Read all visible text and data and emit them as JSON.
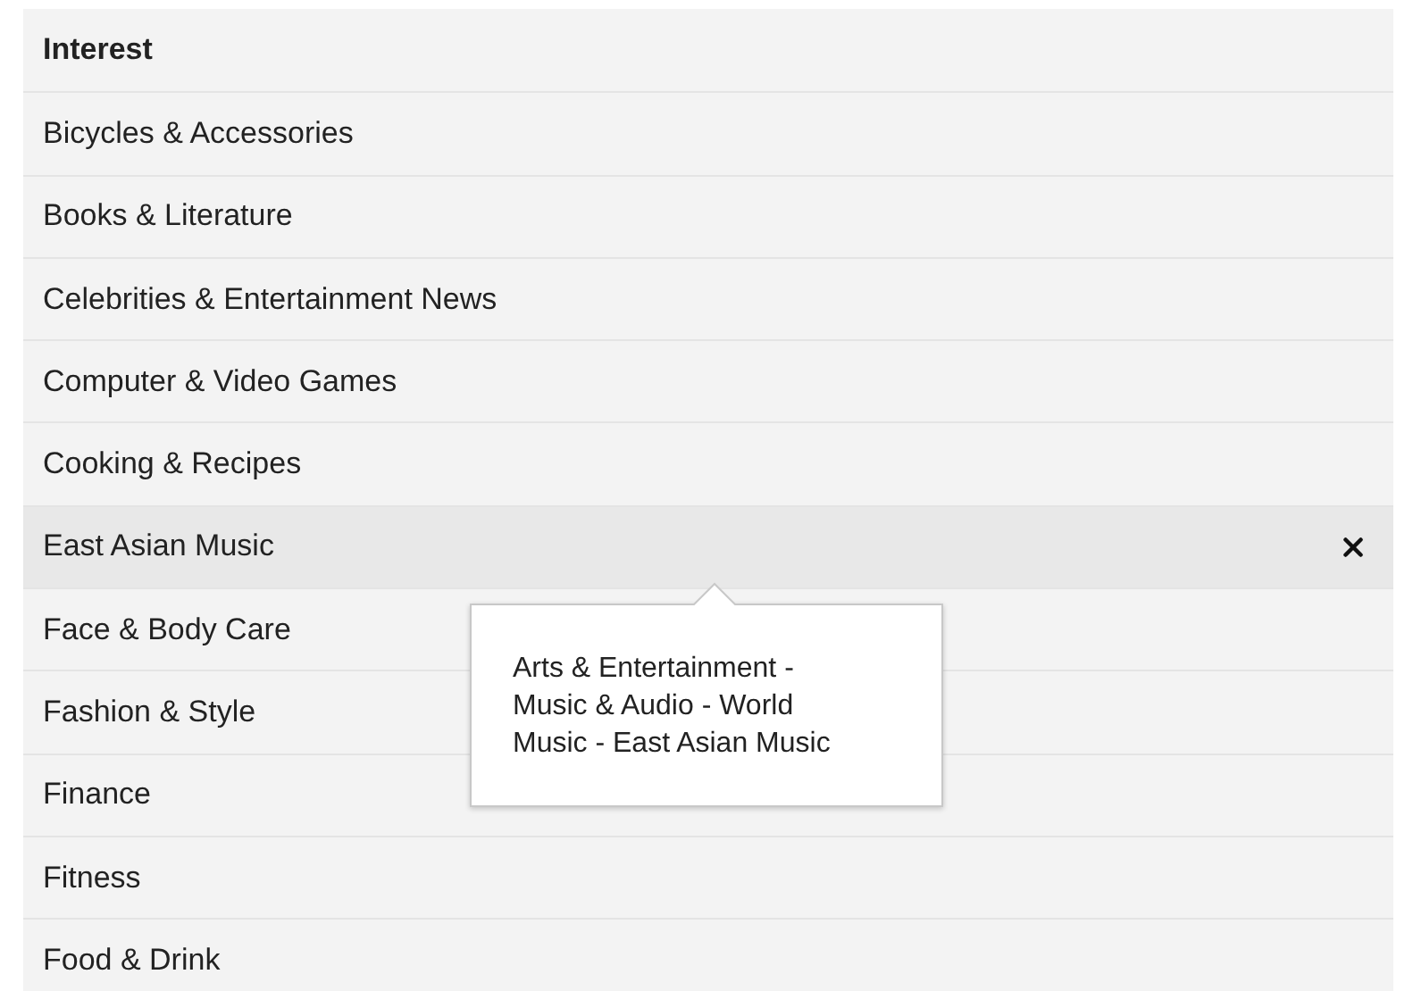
{
  "list": {
    "header": "Interest",
    "items": [
      {
        "label": "Bicycles & Accessories",
        "selected": false
      },
      {
        "label": "Books & Literature",
        "selected": false
      },
      {
        "label": "Celebrities & Entertainment News",
        "selected": false
      },
      {
        "label": "Computer & Video Games",
        "selected": false
      },
      {
        "label": "Cooking & Recipes",
        "selected": false
      },
      {
        "label": "East Asian Music",
        "selected": true,
        "tooltip": "Arts & Entertainment - Music & Audio - World Music - East Asian Music"
      },
      {
        "label": "Face & Body Care",
        "selected": false
      },
      {
        "label": "Fashion & Style",
        "selected": false
      },
      {
        "label": "Finance",
        "selected": false
      },
      {
        "label": "Fitness",
        "selected": false
      },
      {
        "label": "Food & Drink",
        "selected": false
      }
    ]
  }
}
